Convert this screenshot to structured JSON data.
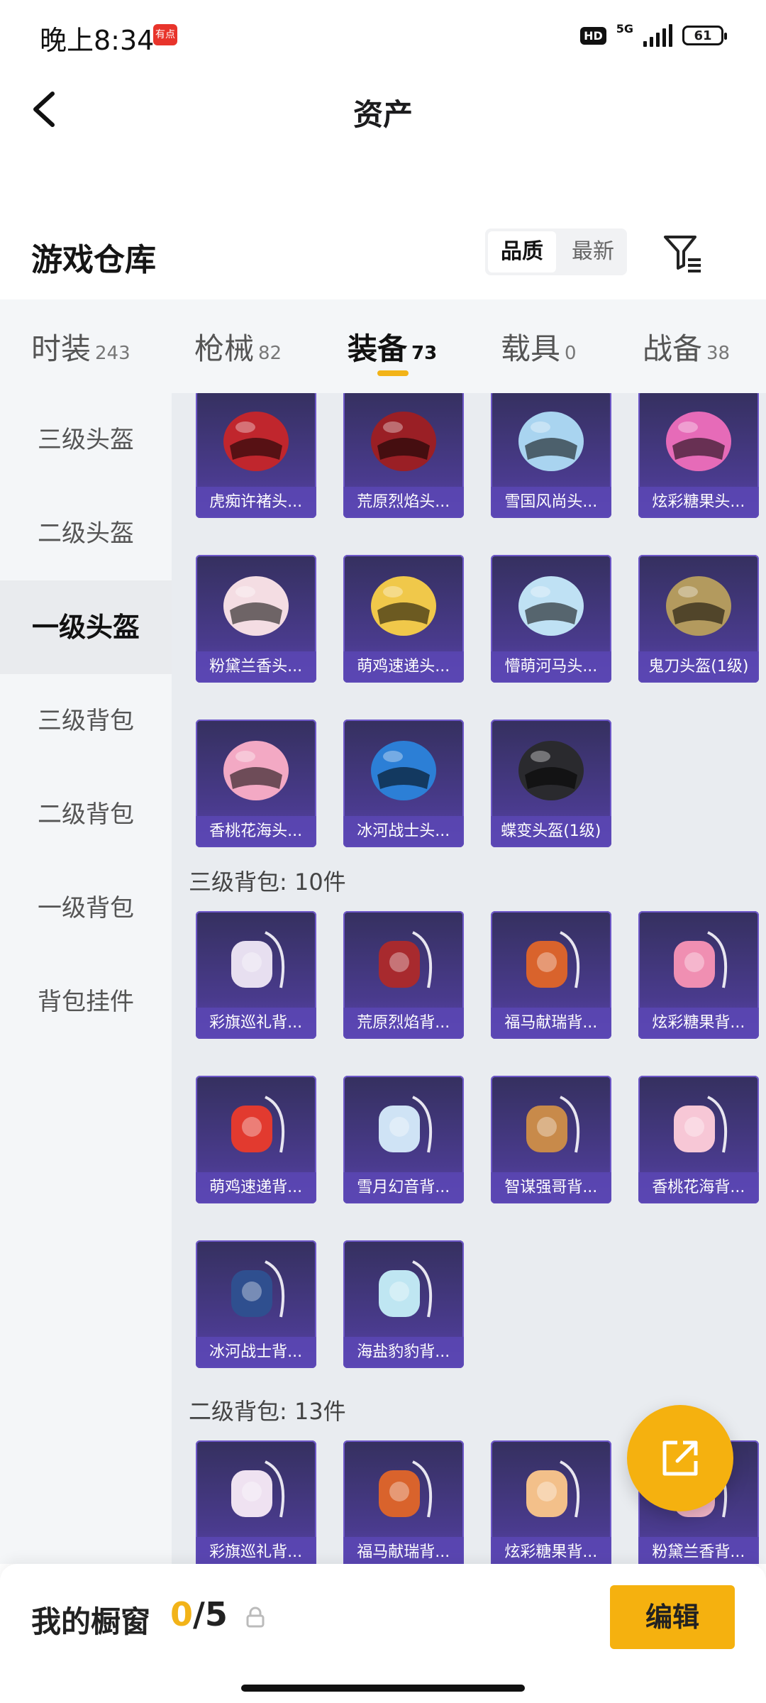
{
  "status_bar": {
    "time": "晚上8:34",
    "app_badge": "有点",
    "hd": "HD",
    "network": "5G",
    "battery": "61"
  },
  "header": {
    "title": "资产"
  },
  "warehouse": {
    "title": "游戏仓库",
    "sort_options": [
      "品质",
      "最新"
    ],
    "active_sort": "品质"
  },
  "tabs": [
    {
      "label": "时装",
      "count": "243"
    },
    {
      "label": "枪械",
      "count": "82"
    },
    {
      "label": "装备",
      "count": "73"
    },
    {
      "label": "载具",
      "count": "0"
    },
    {
      "label": "战备",
      "count": "38"
    }
  ],
  "active_tab": "装备",
  "sidebar": [
    {
      "label": "三级头盔"
    },
    {
      "label": "二级头盔"
    },
    {
      "label": "一级头盔"
    },
    {
      "label": "三级背包"
    },
    {
      "label": "二级背包"
    },
    {
      "label": "一级背包"
    },
    {
      "label": "背包挂件"
    }
  ],
  "active_sidebar": "一级头盔",
  "sections": {
    "helmets_1": {
      "items": [
        "虎痴许褚头...",
        "荒原烈焰头...",
        "雪国风尚头...",
        "炫彩糖果头...",
        "粉黛兰香头...",
        "萌鸡速递头...",
        "懵萌河马头...",
        "鬼刀头盔(1级)",
        "香桃花海头...",
        "冰河战士头...",
        "蝶变头盔(1级)"
      ]
    },
    "backpack_3": {
      "title": "三级背包: 10件",
      "items": [
        "彩旗巡礼背...",
        "荒原烈焰背...",
        "福马献瑞背...",
        "炫彩糖果背...",
        "萌鸡速递背...",
        "雪月幻音背...",
        "智谋强哥背...",
        "香桃花海背...",
        "冰河战士背...",
        "海盐豹豹背..."
      ]
    },
    "backpack_2": {
      "title": "二级背包: 13件",
      "items": [
        "彩旗巡礼背...",
        "福马献瑞背...",
        "炫彩糖果背...",
        "粉黛兰香背..."
      ]
    }
  },
  "item_colors": {
    "helmets_1": [
      "#c0262d",
      "#9a1f25",
      "#a9d4f0",
      "#e66bb8",
      "#f4dde3",
      "#f0c84a",
      "#bfe1f4",
      "#b39a5e",
      "#f3a9c4",
      "#2c7fd6",
      "#2a2a2e"
    ],
    "backpack_3": [
      "#e7dff0",
      "#a82a2e",
      "#d9632c",
      "#f08fb2",
      "#e23a2f",
      "#cfe3f5",
      "#c88a4a",
      "#f7c7d6",
      "#2f4f8f",
      "#bfe6f2"
    ],
    "backpack_2": [
      "#efe2f1",
      "#d9632c",
      "#f3c08a",
      "#f3b6c8"
    ]
  },
  "bottom_bar": {
    "showcase_label": "我的橱窗",
    "current": "0",
    "separator": "/",
    "max": "5",
    "edit_label": "编辑"
  },
  "colors": {
    "accent": "#f5b10f",
    "card_bg": "#4a3b8e"
  }
}
